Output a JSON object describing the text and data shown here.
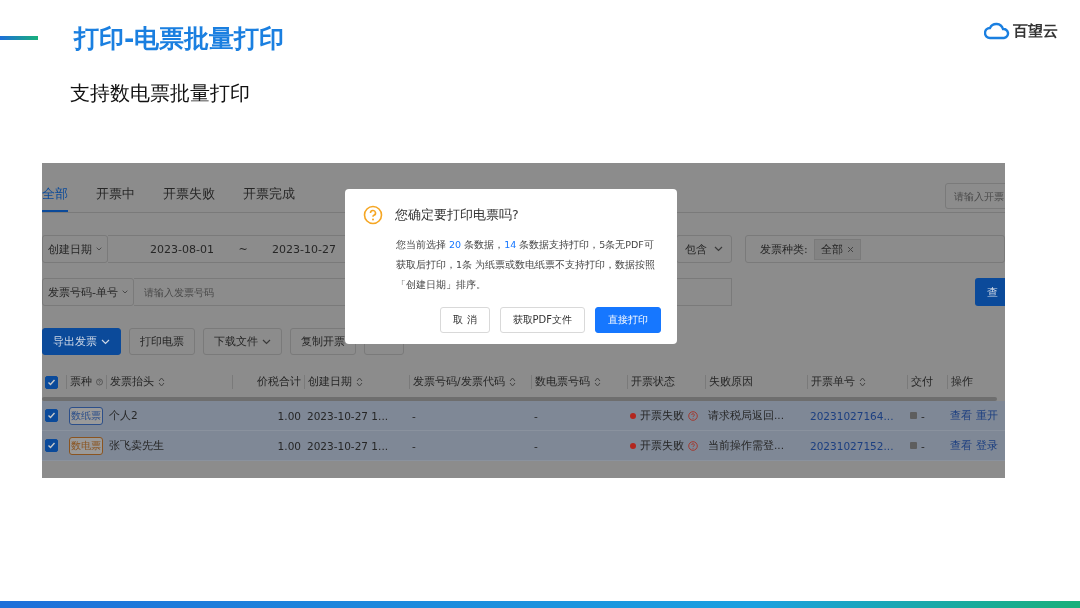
{
  "header": {
    "title": "打印-电票批量打印",
    "logo_text": "百望云"
  },
  "subtitle": "支持数电票批量打印",
  "app": {
    "tabs": [
      {
        "label": "全部",
        "selected": true
      },
      {
        "label": "开票中",
        "selected": false
      },
      {
        "label": "开票失败",
        "selected": false
      },
      {
        "label": "开票完成",
        "selected": false
      }
    ],
    "search_placeholder": "请输入开票",
    "filters": {
      "date_field": "创建日期",
      "date_start": "2023-08-01",
      "date_sep": "~",
      "date_end": "2023-10-27",
      "match_select": "包含",
      "type_label": "发票种类:",
      "type_tag": "全部",
      "number_field": "发票号码-单号",
      "number_placeholder": "请输入发票号码",
      "query_button": "查"
    },
    "toolbar": [
      {
        "label": "导出发票",
        "kind": "primary",
        "dropdown": true
      },
      {
        "label": "打印电票",
        "kind": "default",
        "dropdown": false
      },
      {
        "label": "下载文件",
        "kind": "default",
        "dropdown": true
      },
      {
        "label": "复制开票",
        "kind": "default",
        "dropdown": false
      },
      {
        "kind": "covered"
      }
    ],
    "select_all": true,
    "columns": [
      {
        "label": "票种",
        "help": true,
        "sortable": false
      },
      {
        "label": "发票抬头",
        "help": false,
        "sortable": true
      },
      {
        "label": "价税合计",
        "help": false,
        "sortable": false
      },
      {
        "label": "创建日期",
        "help": false,
        "sortable": true
      },
      {
        "label": "发票号码/发票代码",
        "help": false,
        "sortable": true
      },
      {
        "label": "数电票号码",
        "help": false,
        "sortable": true
      },
      {
        "label": "开票状态",
        "help": false,
        "sortable": false
      },
      {
        "label": "失败原因",
        "help": false,
        "sortable": false
      },
      {
        "label": "开票单号",
        "help": false,
        "sortable": true
      },
      {
        "label": "交付",
        "help": false,
        "sortable": false
      },
      {
        "label": "操作",
        "help": false,
        "sortable": false
      }
    ],
    "rows": [
      {
        "checked": true,
        "selected": true,
        "tag": {
          "text": "数纸票",
          "color": "#2c4f8a"
        },
        "title": "个人2",
        "amount": "1.00",
        "created": "2023-10-27 1...",
        "invoice_no": "-",
        "digital_no": "-",
        "status": {
          "text": "开票失败",
          "color": "#b3261e"
        },
        "reason": "请求税局返回...",
        "order_no": "20231027164...",
        "delivery": "-",
        "actions": [
          "查看",
          "重开"
        ]
      },
      {
        "checked": true,
        "selected": true,
        "tag": {
          "text": "数电票",
          "color": "#8a5420"
        },
        "title": "张飞卖先生",
        "amount": "1.00",
        "created": "2023-10-27 1...",
        "invoice_no": "-",
        "digital_no": "-",
        "status": {
          "text": "开票失败",
          "color": "#b3261e"
        },
        "reason": "当前操作需登...",
        "order_no": "20231027152...",
        "delivery": "-",
        "actions": [
          "查看",
          "登录"
        ]
      }
    ]
  },
  "dialog": {
    "title": "您确定要打印电票吗?",
    "body": [
      {
        "text": "您当前选择 ",
        "highlight": false
      },
      {
        "text": "20",
        "highlight": true
      },
      {
        "text": " 条数据，",
        "highlight": false
      },
      {
        "text": "14",
        "highlight": true
      },
      {
        "text": " 条数据支持打印，5条无PDF可获取后打印，1条 为纸票或数电纸票不支持打印，数据按照「创建日期」排序。",
        "highlight": false
      }
    ],
    "buttons": [
      {
        "label": "取 消",
        "kind": "default"
      },
      {
        "label": "获取PDF文件",
        "kind": "default"
      },
      {
        "label": "直接打印",
        "kind": "primary"
      }
    ]
  }
}
